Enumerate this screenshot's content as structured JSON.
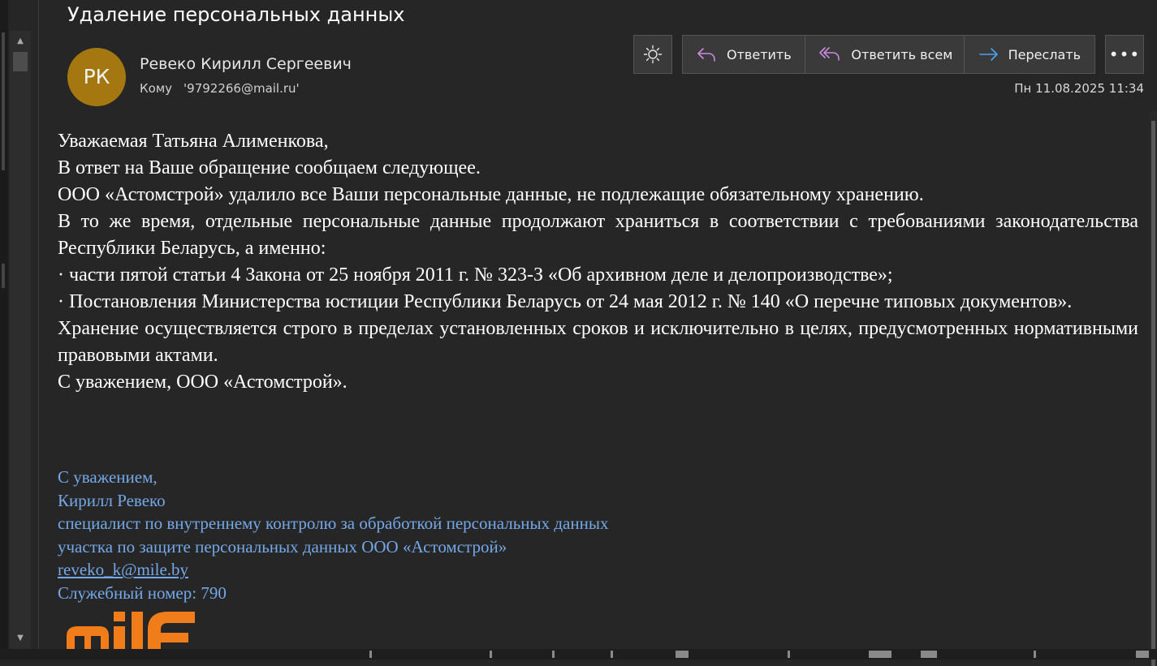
{
  "message": {
    "subject": "Удаление персональных данных",
    "sender": {
      "initials": "РК",
      "avatar_color": "#a47710",
      "name": "Ревеко Кирилл Сергеевич"
    },
    "to_label": "Кому",
    "to_address": "'9792266@mail.ru'",
    "date": "Пн 11.08.2025 11:34"
  },
  "toolbar": {
    "theme_icon": "sun-icon",
    "reply_label": "Ответить",
    "reply_all_label": "Ответить всем",
    "forward_label": "Переслать",
    "more_label": "•••"
  },
  "body": {
    "paragraphs": [
      "Уважаемая Татьяна Алименкова,",
      "В ответ на Ваше обращение сообщаем следующее.",
      "ООО «Астомстрой» удалило все Ваши персональные данные, не подлежащие обязательному хранению.",
      "В то же время, отдельные персональные данные продолжают храниться в соответствии с требованиями законодательства Республики Беларусь, а именно:",
      "· части пятой статьи 4 Закона от 25 ноября 2011 г. № 323-З «Об архивном деле и делопроизводстве»;",
      "· Постановления Министерства юстиции Республики Беларусь от 24 мая 2012 г. № 140 «О перечне типовых документов».",
      "Хранение осуществляется строго в пределах установленных сроков и исключительно в целях, предусмотренных нормативными правовыми актами.",
      "С уважением, ООО «Астомстрой»."
    ]
  },
  "signature": {
    "color": "#74a8e8",
    "lines": [
      "С уважением,",
      "Кирилл Ревеко",
      "специалист по внутреннему контролю за обработкой персональных данных",
      "участка по защите персональных данных ООО «Астомстрой»"
    ],
    "email": "reveko_k@mile.by",
    "ext": "Служебный номер: 790"
  },
  "logo": {
    "color": "#f07d1a"
  }
}
